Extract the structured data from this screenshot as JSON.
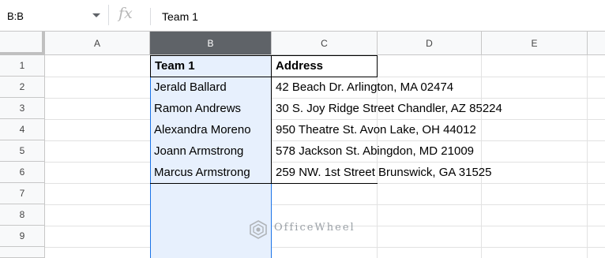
{
  "formula_bar": {
    "name_box": "B:B",
    "fx_icon": "fx",
    "formula_value": "Team 1"
  },
  "columns": [
    "A",
    "B",
    "C",
    "D",
    "E"
  ],
  "selected_column": "B",
  "rows": [
    "1",
    "2",
    "3",
    "4",
    "5",
    "6",
    "7",
    "8",
    "9"
  ],
  "table": {
    "headers": [
      "Team 1",
      "Address"
    ],
    "rows": [
      [
        "Jerald Ballard",
        "42 Beach Dr. Arlington, MA 02474"
      ],
      [
        "Ramon Andrews",
        "30 S. Joy Ridge Street Chandler, AZ 85224"
      ],
      [
        "Alexandra Moreno",
        "950 Theatre St. Avon Lake, OH 44012"
      ],
      [
        "Joann Armstrong",
        "578 Jackson St. Abingdon, MD 21009"
      ],
      [
        "Marcus Armstrong",
        "259 NW. 1st Street Brunswick, GA 31525"
      ]
    ]
  },
  "watermark": {
    "text": "OfficeWheel",
    "icon": "officewheel-logo-icon"
  },
  "colors": {
    "selection_blue": "#1a73e8",
    "selection_fill": "#e7f0fd",
    "selected_header": "#5f6368"
  }
}
